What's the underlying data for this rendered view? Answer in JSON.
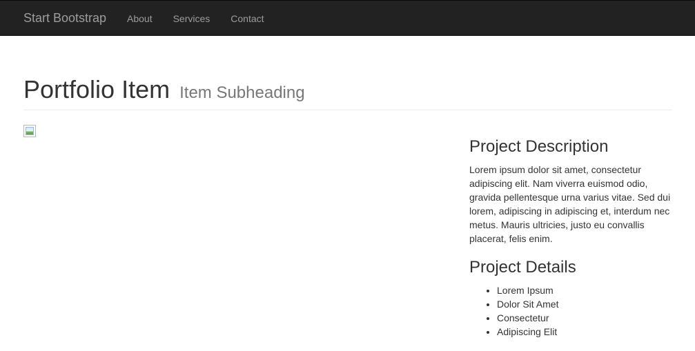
{
  "navbar": {
    "brand": "Start Bootstrap",
    "links": [
      "About",
      "Services",
      "Contact"
    ]
  },
  "header": {
    "title": "Portfolio Item",
    "subtitle": "Item Subheading"
  },
  "project": {
    "description_heading": "Project Description",
    "description_text": "Lorem ipsum dolor sit amet, consectetur adipiscing elit. Nam viverra euismod odio, gravida pellentesque urna varius vitae. Sed dui lorem, adipiscing in adipiscing et, interdum nec metus. Mauris ultricies, justo eu convallis placerat, felis enim.",
    "details_heading": "Project Details",
    "details_items": [
      "Lorem Ipsum",
      "Dolor Sit Amet",
      "Consectetur",
      "Adipiscing Elit"
    ]
  },
  "icons": {
    "image": "broken-image-icon"
  },
  "colors": {
    "navbar_bg": "#222222",
    "nav_text": "#9d9d9d",
    "subtitle": "#777777"
  }
}
